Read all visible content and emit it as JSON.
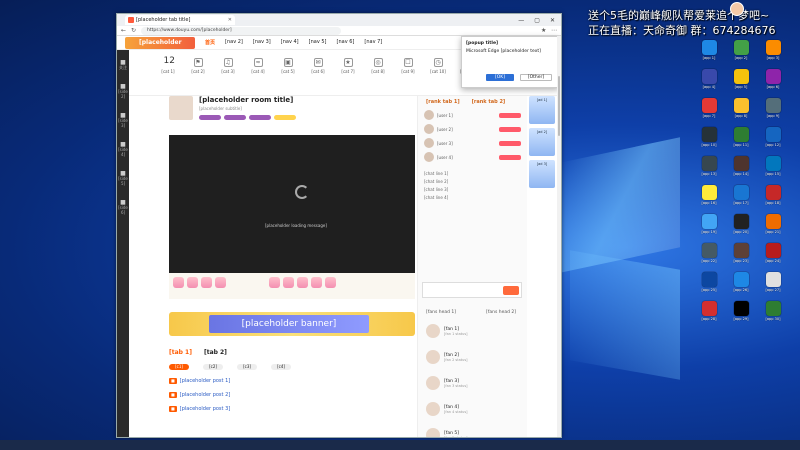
{
  "overlay": {
    "line1": "送个5毛的巅峰舰队帮爱莱追个梦吧~",
    "line2": "正在直播：天命奇御 群：674284676"
  },
  "browser": {
    "tab_title": "[placeholder tab title]",
    "url": "https://www.douyu.com/[placeholder]",
    "window_buttons": [
      "—",
      "▢",
      "✕"
    ]
  },
  "site": {
    "logo": "[placeholder logo]",
    "nav": [
      "首页",
      "[nav 2]",
      "[nav 3]",
      "[nav 4]",
      "[nav 5]",
      "[nav 6]",
      "[nav 7]"
    ]
  },
  "sidebar": [
    "关注",
    "[side 2]",
    "[side 3]",
    "[side 4]",
    "[side 5]",
    "[side 6]"
  ],
  "categories": [
    {
      "icon": "12",
      "label": "[cat 1]"
    },
    {
      "icon": "⚑",
      "label": "[cat 2]"
    },
    {
      "icon": "♫",
      "label": "[cat 3]"
    },
    {
      "icon": "≈",
      "label": "[cat 4]"
    },
    {
      "icon": "▣",
      "label": "[cat 5]"
    },
    {
      "icon": "✉",
      "label": "[cat 6]"
    },
    {
      "icon": "★",
      "label": "[cat 7]"
    },
    {
      "icon": "◎",
      "label": "[cat 8]"
    },
    {
      "icon": "☐",
      "label": "[cat 9]"
    },
    {
      "icon": "◷",
      "label": "[cat 10]"
    },
    {
      "icon": "⇧",
      "label": "[cat 11]"
    },
    {
      "icon": "✎",
      "label": "[cat 12]"
    }
  ],
  "popup": {
    "title": "[popup title]",
    "body": "Microsoft Edge [placeholder text]",
    "primary": "[OK]",
    "secondary": "[Other]"
  },
  "room": {
    "title": "[placeholder room title]",
    "subtitle": "[placeholder subtitle]"
  },
  "video": {
    "message": "[placeholder loading message]"
  },
  "banner": {
    "text": "[placeholder banner]"
  },
  "section": {
    "tabs": [
      "[tab 1]",
      "[tab 2]"
    ],
    "chips": [
      "[c1]",
      "[c2]",
      "[c3]",
      "[c4]"
    ],
    "posts": [
      "[placeholder post 1]",
      "[placeholder post 2]",
      "[placeholder post 3]"
    ]
  },
  "rank": {
    "tabs": [
      "[rank tab 1]",
      "[rank tab 2]"
    ],
    "rows": [
      "[user 1]",
      "[user 2]",
      "[user 3]",
      "[user 4]"
    ]
  },
  "chat": [
    "[chat line 1]",
    "[chat line 2]",
    "[chat line 3]",
    "[chat line 4]"
  ],
  "fans": {
    "heads": [
      "[fans head 1]",
      "[fans head 2]"
    ],
    "list": [
      {
        "name": "[fan 1]",
        "sub": "[fan 1 status]"
      },
      {
        "name": "[fan 2]",
        "sub": "[fan 2 status]"
      },
      {
        "name": "[fan 3]",
        "sub": "[fan 3 status]"
      },
      {
        "name": "[fan 4]",
        "sub": "[fan 4 status]"
      },
      {
        "name": "[fan 5]",
        "sub": "[fan 5 status]"
      }
    ]
  },
  "ads": [
    "[ad 1]",
    "[ad 2]",
    "[ad 3]"
  ],
  "desktop_icons": [
    {
      "label": "[app 1]",
      "color": "#1e88e5"
    },
    {
      "label": "[app 2]",
      "color": "#43a047"
    },
    {
      "label": "[app 3]",
      "color": "#fb8c00"
    },
    {
      "label": "[app 4]",
      "color": "#3949ab"
    },
    {
      "label": "[app 5]",
      "color": "#f4c20d"
    },
    {
      "label": "[app 6]",
      "color": "#8e24aa"
    },
    {
      "label": "[app 7]",
      "color": "#e53935"
    },
    {
      "label": "[app 8]",
      "color": "#fbc02d"
    },
    {
      "label": "[app 9]",
      "color": "#546e7a"
    },
    {
      "label": "[app 10]",
      "color": "#263238"
    },
    {
      "label": "[app 11]",
      "color": "#2e7d32"
    },
    {
      "label": "[app 12]",
      "color": "#1565c0"
    },
    {
      "label": "[app 13]",
      "color": "#37474f"
    },
    {
      "label": "[app 14]",
      "color": "#4e342e"
    },
    {
      "label": "[app 15]",
      "color": "#0277bd"
    },
    {
      "label": "[app 16]",
      "color": "#ffeb3b"
    },
    {
      "label": "[app 17]",
      "color": "#1976d2"
    },
    {
      "label": "[app 18]",
      "color": "#c62828"
    },
    {
      "label": "[app 19]",
      "color": "#42a5f5"
    },
    {
      "label": "[app 20]",
      "color": "#212121"
    },
    {
      "label": "[app 21]",
      "color": "#ef6c00"
    },
    {
      "label": "[app 22]",
      "color": "#455a64"
    },
    {
      "label": "[app 23]",
      "color": "#5d4037"
    },
    {
      "label": "[app 24]",
      "color": "#b71c1c"
    },
    {
      "label": "[app 25]",
      "color": "#0d47a1"
    },
    {
      "label": "[app 26]",
      "color": "#1e88e5"
    },
    {
      "label": "[app 27]",
      "color": "#e0e0e0"
    },
    {
      "label": "[app 28]",
      "color": "#d32f2f"
    },
    {
      "label": "[app 29]",
      "color": "#000000"
    },
    {
      "label": "[app 30]",
      "color": "#2e7d32"
    }
  ]
}
